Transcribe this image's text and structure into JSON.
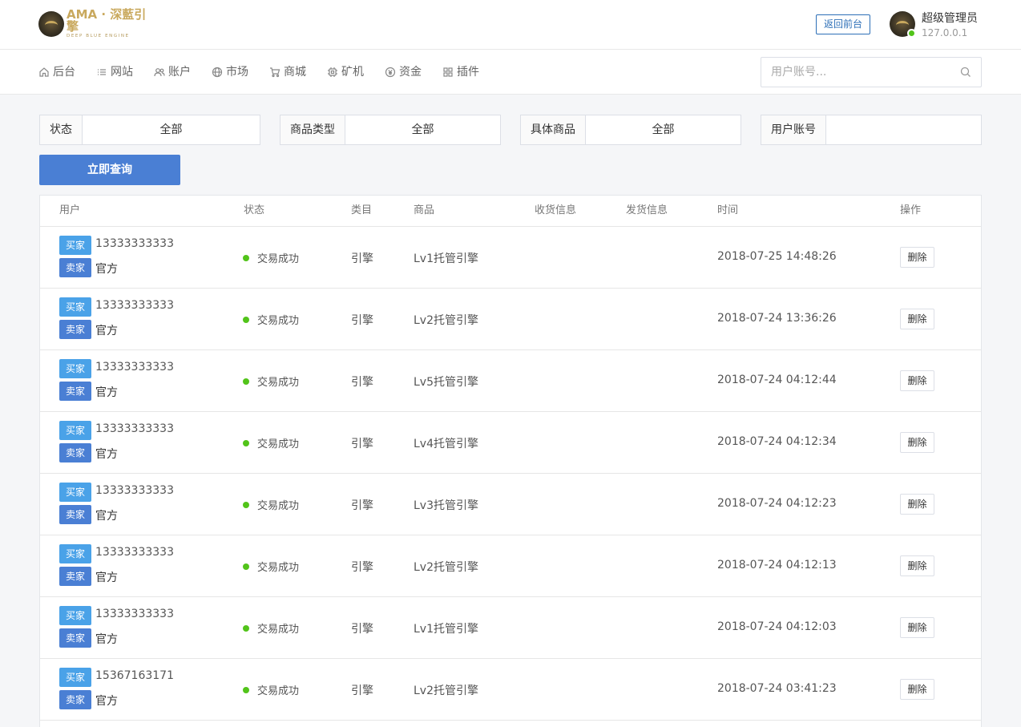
{
  "header": {
    "logo_main": "AMA · 深藍引擎",
    "logo_sub": "DEEP BLUE ENGINE",
    "back_button": "返回前台",
    "admin_name": "超级管理员",
    "admin_ip": "127.0.0.1"
  },
  "nav": {
    "items": [
      {
        "label": "后台",
        "icon": "home-icon"
      },
      {
        "label": "网站",
        "icon": "list-icon"
      },
      {
        "label": "账户",
        "icon": "users-icon"
      },
      {
        "label": "市场",
        "icon": "globe-icon"
      },
      {
        "label": "商城",
        "icon": "cart-icon"
      },
      {
        "label": "矿机",
        "icon": "chip-icon"
      },
      {
        "label": "资金",
        "icon": "money-icon"
      },
      {
        "label": "插件",
        "icon": "grid-icon"
      }
    ],
    "search_placeholder": "用户账号..."
  },
  "filters": {
    "status": {
      "label": "状态",
      "value": "全部"
    },
    "category": {
      "label": "商品类型",
      "value": "全部"
    },
    "product": {
      "label": "具体商品",
      "value": "全部"
    },
    "account": {
      "label": "用户账号",
      "value": ""
    },
    "query_button": "立即查询"
  },
  "table": {
    "columns": [
      "用户",
      "状态",
      "类目",
      "商品",
      "收货信息",
      "发货信息",
      "时间",
      "操作"
    ],
    "buyer_tag": "买家",
    "seller_tag": "卖家",
    "delete_label": "删除",
    "rows": [
      {
        "buyer": "13333333333",
        "seller": "官方",
        "status": "交易成功",
        "category": "引擎",
        "product": "Lv1托管引擎",
        "receive": "",
        "ship": "",
        "time": "2018-07-25 14:48:26"
      },
      {
        "buyer": "13333333333",
        "seller": "官方",
        "status": "交易成功",
        "category": "引擎",
        "product": "Lv2托管引擎",
        "receive": "",
        "ship": "",
        "time": "2018-07-24 13:36:26"
      },
      {
        "buyer": "13333333333",
        "seller": "官方",
        "status": "交易成功",
        "category": "引擎",
        "product": "Lv5托管引擎",
        "receive": "",
        "ship": "",
        "time": "2018-07-24 04:12:44"
      },
      {
        "buyer": "13333333333",
        "seller": "官方",
        "status": "交易成功",
        "category": "引擎",
        "product": "Lv4托管引擎",
        "receive": "",
        "ship": "",
        "time": "2018-07-24 04:12:34"
      },
      {
        "buyer": "13333333333",
        "seller": "官方",
        "status": "交易成功",
        "category": "引擎",
        "product": "Lv3托管引擎",
        "receive": "",
        "ship": "",
        "time": "2018-07-24 04:12:23"
      },
      {
        "buyer": "13333333333",
        "seller": "官方",
        "status": "交易成功",
        "category": "引擎",
        "product": "Lv2托管引擎",
        "receive": "",
        "ship": "",
        "time": "2018-07-24 04:12:13"
      },
      {
        "buyer": "13333333333",
        "seller": "官方",
        "status": "交易成功",
        "category": "引擎",
        "product": "Lv1托管引擎",
        "receive": "",
        "ship": "",
        "time": "2018-07-24 04:12:03"
      },
      {
        "buyer": "15367163171",
        "seller": "官方",
        "status": "交易成功",
        "category": "引擎",
        "product": "Lv2托管引擎",
        "receive": "",
        "ship": "",
        "time": "2018-07-24 03:41:23"
      }
    ]
  },
  "colors": {
    "primary": "#4a7fd4",
    "buyer_tag": "#4aa2e8",
    "success": "#52c41a",
    "logo_gold": "#c9a95e"
  }
}
